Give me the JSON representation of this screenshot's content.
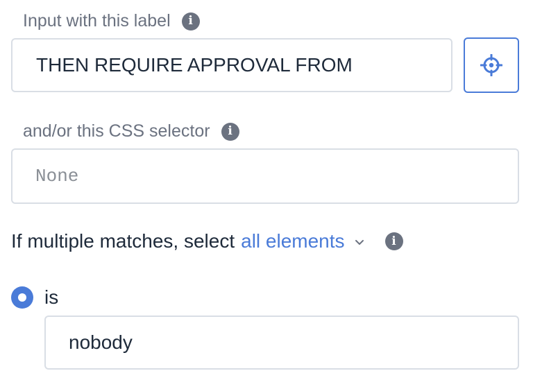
{
  "label_field": {
    "label": "Input with this label",
    "value": "THEN REQUIRE APPROVAL FROM",
    "info_icon": "info-icon",
    "picker_icon": "crosshair-icon"
  },
  "css_field": {
    "label": "and/or this CSS selector",
    "placeholder": "None",
    "info_icon": "info-icon"
  },
  "multiple_matches": {
    "prefix": "If multiple matches, select",
    "selected_option": "all elements",
    "chevron_icon": "chevron-down-icon",
    "info_icon": "info-icon"
  },
  "condition": {
    "radio_label": "is",
    "radio_selected": true,
    "value": "nobody"
  },
  "colors": {
    "accent": "#4a7bd8",
    "muted_text": "#6b7280",
    "border": "#d9dee5",
    "text": "#1e2a3a"
  }
}
